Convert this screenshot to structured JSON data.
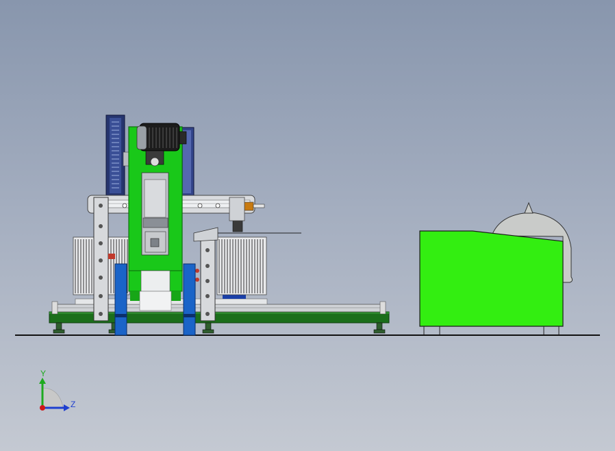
{
  "viewport": {
    "background_top": "#8896ad",
    "background_bottom": "#c4c9d2"
  },
  "model": {
    "parts": [
      "ground-line",
      "machine-base-frame",
      "motor",
      "pulley-guard-left",
      "pulley-guard-right",
      "press-frame",
      "crossbeam-rail",
      "side-frame-left",
      "side-frame-right",
      "blue-column-left",
      "blue-column-right",
      "heat-sink-left",
      "heat-sink-right",
      "leveling-feet",
      "electrical-cabinet",
      "tank-dome"
    ],
    "colors": {
      "green_primary": "#19c819",
      "green_bright": "#33ee11",
      "green_dark": "#1b6e1b",
      "blue_column": "#1a64c8",
      "navy_guard": "#26356e",
      "steel_light": "#d7d9dc",
      "steel_mid": "#a8adb3",
      "motor_black": "#1c1c1c",
      "outline": "#202020"
    }
  },
  "triad": {
    "y_label": "Y",
    "z_label": "Z",
    "y_color": "#1faa1f",
    "z_color": "#1f3fcf",
    "origin_color": "#d01818"
  }
}
